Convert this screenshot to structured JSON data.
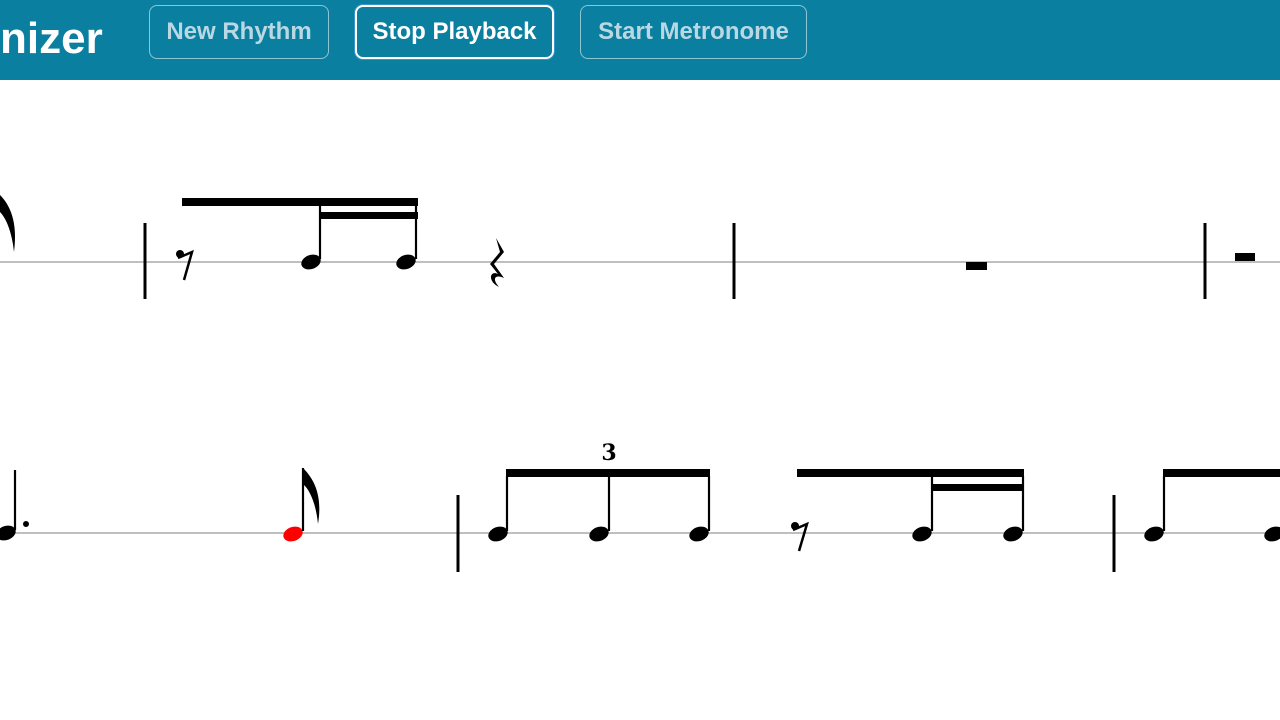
{
  "header": {
    "title": "nizer",
    "buttons": {
      "new_rhythm": "New Rhythm",
      "stop_playback": "Stop Playback",
      "start_metronome": "Start Metronome"
    }
  },
  "notation": {
    "tuplet_number": "3",
    "playing_note_color": "#ff0000",
    "ink_color": "#000000",
    "staff_line_color": "#aaaaaa",
    "icons": [
      "eighth-rest-icon",
      "quarter-rest-icon",
      "half-rest-icon",
      "eighth-flag-icon",
      "augmentation-dot-icon"
    ]
  },
  "colors": {
    "header_bg": "#0a7fa0",
    "button_text_inactive": "#b9d8e3",
    "button_text_active": "#ffffff"
  }
}
